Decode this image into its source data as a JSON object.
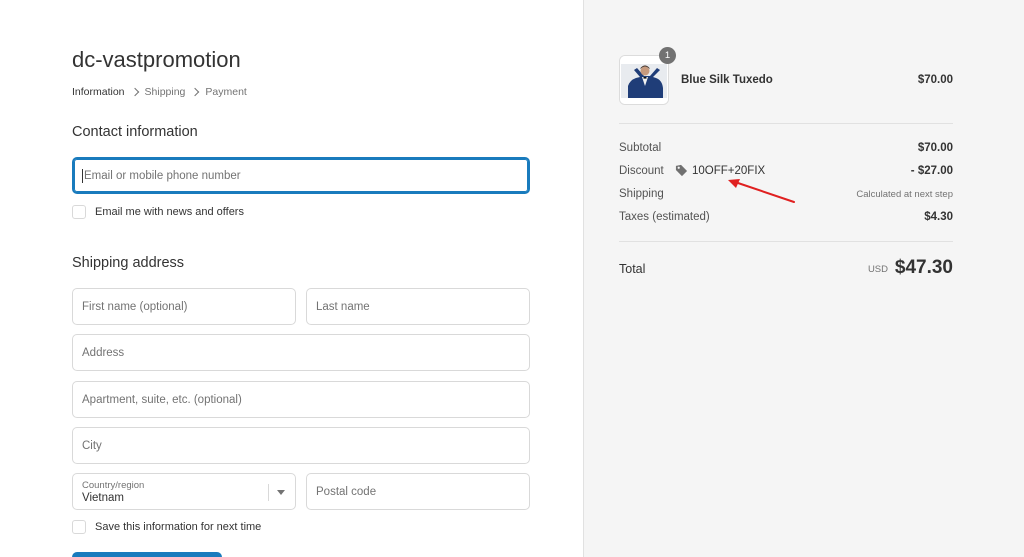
{
  "shop": {
    "name": "dc-vastpromotion"
  },
  "breadcrumb": [
    {
      "label": "Information",
      "active": true
    },
    {
      "label": "Shipping",
      "active": false
    },
    {
      "label": "Payment",
      "active": false
    }
  ],
  "contact": {
    "title": "Contact information",
    "email_placeholder": "Email or mobile phone number",
    "newsletter_label": "Email me with news and offers"
  },
  "shipping": {
    "title": "Shipping address",
    "first_name_placeholder": "First name (optional)",
    "last_name_placeholder": "Last name",
    "address_placeholder": "Address",
    "apartment_placeholder": "Apartment, suite, etc. (optional)",
    "city_placeholder": "City",
    "country_label": "Country/region",
    "country_value": "Vietnam",
    "postal_placeholder": "Postal code",
    "save_info_label": "Save this information for next time"
  },
  "order": {
    "item": {
      "name": "Blue Silk Tuxedo",
      "price": "$70.00",
      "quantity": "1"
    },
    "subtotal_label": "Subtotal",
    "subtotal_value": "$70.00",
    "discount_label": "Discount",
    "discount_code": "10OFF+20FIX",
    "discount_value": "- $27.00",
    "shipping_label": "Shipping",
    "shipping_value": "Calculated at next step",
    "taxes_label": "Taxes (estimated)",
    "taxes_value": "$4.30",
    "total_label": "Total",
    "total_currency": "USD",
    "total_value": "$47.30"
  },
  "colors": {
    "accent": "#197bbd",
    "sidebar_bg": "#f5f5f5",
    "annotation": "#e02020"
  }
}
